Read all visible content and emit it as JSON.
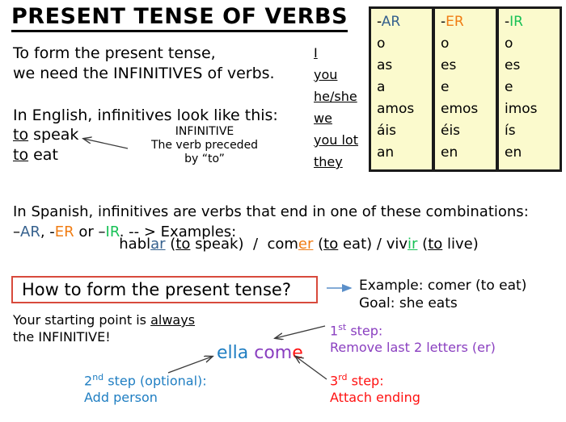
{
  "title": "PRESENT TENSE OF VERBS",
  "intro": {
    "line1": "To form the present tense,",
    "line2": "we need the INFINITIVES of verbs."
  },
  "english": {
    "heading": "In English, infinitives look like this:",
    "example1_to": "to",
    "example1_rest": " speak",
    "example2_to": "to",
    "example2_rest": " eat",
    "note_title": "INFINITIVE",
    "note_line1": "The verb preceded",
    "note_line2": "by “to”"
  },
  "spanish": {
    "line1": "In Spanish, infinitives are verbs that end in one of these combinations:",
    "dash1": "–",
    "ar": "AR",
    "sep1": ", -",
    "er": "ER",
    "sep2": " or –",
    "ir": "IR",
    "tail": ". -- > Examples:",
    "ex_hablar_stem": "habl",
    "ex_hablar_end": "ar",
    "ex_hablar_gloss_to": "to",
    "ex_hablar_gloss_rest": " speak)",
    "ex_comer_stem": "com",
    "ex_comer_end": "er",
    "ex_comer_gloss_to": "to",
    "ex_comer_gloss_rest": " eat)",
    "ex_vivir_stem": "viv",
    "ex_vivir_end": "ir",
    "ex_vivir_gloss_to": "to",
    "ex_vivir_gloss_rest": " live)",
    "slash": "/",
    "open_paren": "("
  },
  "pronouns": [
    "I",
    "you",
    "he/she",
    "we",
    "you lot",
    "they"
  ],
  "ending_tables": [
    {
      "id": "ar",
      "header": "-AR",
      "header_dash": "-",
      "header_letters": "AR",
      "color": "#36618e",
      "endings": [
        "o",
        "as",
        "a",
        "amos",
        "áis",
        "an"
      ]
    },
    {
      "id": "er",
      "header": "-ER",
      "header_dash": "-",
      "header_letters": "ER",
      "color": "#f07c13",
      "endings": [
        "o",
        "es",
        "e",
        "emos",
        "éis",
        "en"
      ]
    },
    {
      "id": "ir",
      "header": "-IR",
      "header_dash": "-",
      "header_letters": "IR",
      "color": "#18c156",
      "endings": [
        "o",
        "es",
        "e",
        "imos",
        "ís",
        "en"
      ]
    }
  ],
  "question_box": {
    "label": "How to form the present tense?",
    "border_color": "#d84a3c"
  },
  "starting_point": {
    "line1_pre": "Your starting point is ",
    "line1_emph": "always",
    "line2": "the INFINITIVE!"
  },
  "example_goal": {
    "example": "Example: comer (to eat)",
    "goal": "Goal: she eats"
  },
  "steps": {
    "step1_num": "1",
    "step1_ord": "st",
    "step1_label": " step:",
    "step1_detail": "Remove last 2 letters (er)",
    "step1_color": "#8a3fc0",
    "step2_num": "2",
    "step2_ord": "nd",
    "step2_label": "  step (optional):",
    "step2_detail": "Add person",
    "step2_color": "#1f7ec2",
    "step3_num": "3",
    "step3_ord": "rd",
    "step3_label": "  step:",
    "step3_detail": "Attach ending",
    "step3_color": "#ff1111"
  },
  "conjugated": {
    "person": "ella",
    "space": " ",
    "stem": "com",
    "ending": "e"
  },
  "arrows": {
    "infinitive_arrow_color": "#3a3a3a",
    "question_arrow_color": "#5b8fc9",
    "step1_arrow_color": "#3a3a3a",
    "step2_arrow_color": "#3a3a3a",
    "step3_arrow_color": "#3a3a3a"
  }
}
